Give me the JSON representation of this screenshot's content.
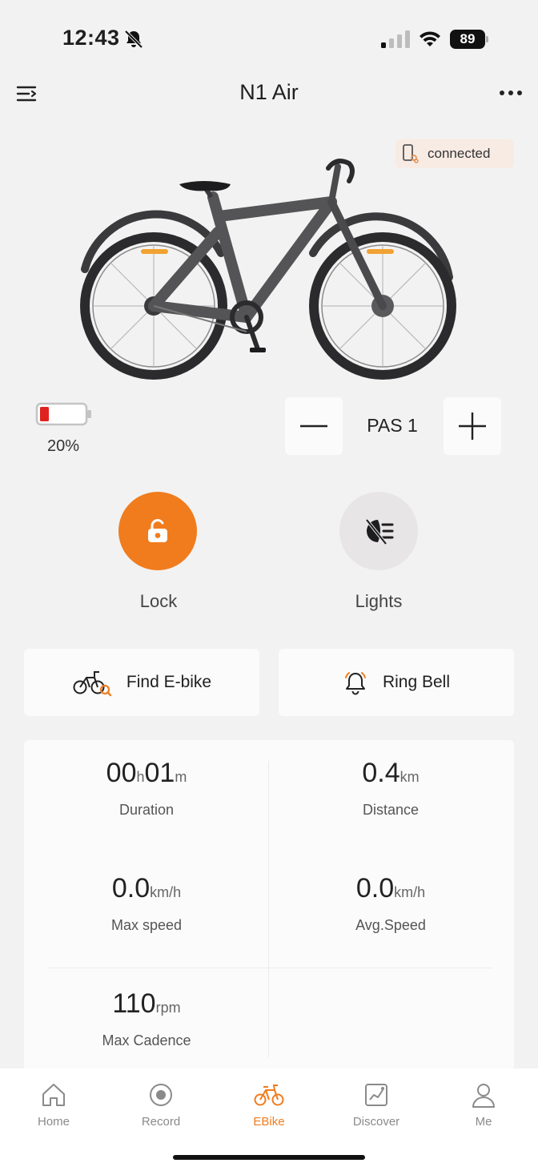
{
  "status_bar": {
    "time": "12:43",
    "battery": "89",
    "icons": [
      "bell-off-icon",
      "cellular-signal-icon",
      "wifi-icon",
      "battery-icon"
    ]
  },
  "header": {
    "title": "N1 Air",
    "menu_icon": "menu-icon",
    "more_icon": "more-dots-icon"
  },
  "connection": {
    "status": "connected",
    "icon": "phone-link-icon"
  },
  "battery": {
    "percent_label": "20%",
    "level": 0.2,
    "color": "#e0231e"
  },
  "assist": {
    "label": "PAS 1",
    "minus_icon": "minus-icon",
    "plus_icon": "plus-icon"
  },
  "controls": {
    "lock": {
      "label": "Lock",
      "icon": "unlocked-icon",
      "color": "#f07c1e"
    },
    "lights": {
      "label": "Lights",
      "icon": "headlight-off-icon"
    }
  },
  "actions": {
    "find": {
      "label": "Find E-bike",
      "icon": "bike-search-icon"
    },
    "ring": {
      "label": "Ring Bell",
      "icon": "bell-ring-icon"
    }
  },
  "stats": {
    "duration": {
      "hours": "00",
      "h_unit": "h",
      "minutes": "01",
      "m_unit": "m",
      "label": "Duration"
    },
    "distance": {
      "value": "0.4",
      "unit": "km",
      "label": "Distance"
    },
    "max_speed": {
      "value": "0.0",
      "unit": "km/h",
      "label": "Max speed"
    },
    "avg_speed": {
      "value": "0.0",
      "unit": "km/h",
      "label": "Avg.Speed"
    },
    "max_cadence": {
      "value": "110",
      "unit": "rpm",
      "label": "Max Cadence"
    }
  },
  "tabs": [
    {
      "label": "Home",
      "icon": "home-icon",
      "active": false
    },
    {
      "label": "Record",
      "icon": "record-icon",
      "active": false
    },
    {
      "label": "EBike",
      "icon": "ebike-icon",
      "active": true
    },
    {
      "label": "Discover",
      "icon": "discover-chart-icon",
      "active": false
    },
    {
      "label": "Me",
      "icon": "person-icon",
      "active": false
    }
  ],
  "accent_color": "#f07c1e"
}
